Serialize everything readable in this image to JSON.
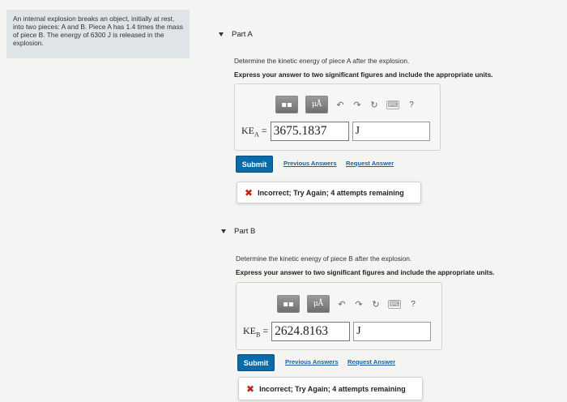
{
  "problem": {
    "text": "An internal explosion breaks an object, initially at rest, into two pieces: A and B. Piece A has 1.4 times the mass of piece B. The energy of 6300 J is released in the explosion."
  },
  "toolbar": {
    "templates_label": "▪▪",
    "mu_label": "μÅ",
    "undo_icon": "undo-icon",
    "redo_icon": "redo-icon",
    "reset_icon": "reset-icon",
    "keyboard_icon": "keyboard-icon",
    "help_label": "?"
  },
  "partA": {
    "title": "Part A",
    "question": "Determine the kinetic energy of piece A after the explosion.",
    "instruction": "Express your answer to two significant figures and include the appropriate units.",
    "ke_label": "KE",
    "ke_sub": "A",
    "equals": "=",
    "value": "3675.1837",
    "unit": "J",
    "submit": "Submit",
    "previous_answers": "Previous Answers",
    "request_answer": "Request Answer",
    "feedback": "Incorrect; Try Again; 4 attempts remaining"
  },
  "partB": {
    "title": "Part B",
    "question": "Determine the kinetic energy of piece B after the explosion.",
    "instruction": "Express your answer to two significant figures and include the appropriate units.",
    "ke_label": "KE",
    "ke_sub": "B",
    "equals": "=",
    "value": "2624.8163",
    "unit": "J",
    "submit": "Submit",
    "previous_answers": "Previous Answers",
    "request_answer": "Request Answer",
    "feedback": "Incorrect; Try Again; 4 attempts remaining"
  },
  "colors": {
    "submit_bg": "#0b6aa8",
    "incorrect_x": "#c0241a",
    "link": "#1a5fa0"
  }
}
